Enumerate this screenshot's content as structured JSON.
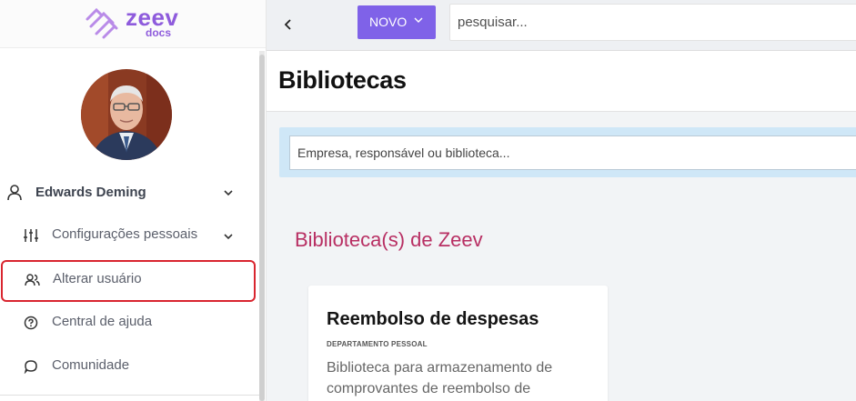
{
  "app": {
    "logo_word": "zeev",
    "logo_sub": "docs",
    "brand_color": "#8e5bdc"
  },
  "sidebar": {
    "user_name": "Edwards Deming",
    "items": [
      {
        "label": "Configurações pessoais",
        "icon": "sliders-icon"
      },
      {
        "label": "Alterar usuário",
        "icon": "users-icon"
      },
      {
        "label": "Central de ajuda",
        "icon": "help-circle-icon"
      },
      {
        "label": "Comunidade",
        "icon": "chat-bubble-icon"
      }
    ]
  },
  "topbar": {
    "new_label": "NOVO",
    "search_placeholder": "pesquisar..."
  },
  "page": {
    "title": "Bibliotecas",
    "filter_placeholder": "Empresa, responsável ou biblioteca...",
    "section_title": "Biblioteca(s) de Zeev"
  },
  "cards": [
    {
      "title": "Reembolso de despesas",
      "department": "DEPARTAMENTO PESSOAL",
      "description": "Biblioteca para armazenamento de comprovantes de reembolso de"
    }
  ],
  "colors": {
    "accent": "#7f62e8",
    "section_title": "#b82f63",
    "highlight_border": "#d9252f"
  }
}
